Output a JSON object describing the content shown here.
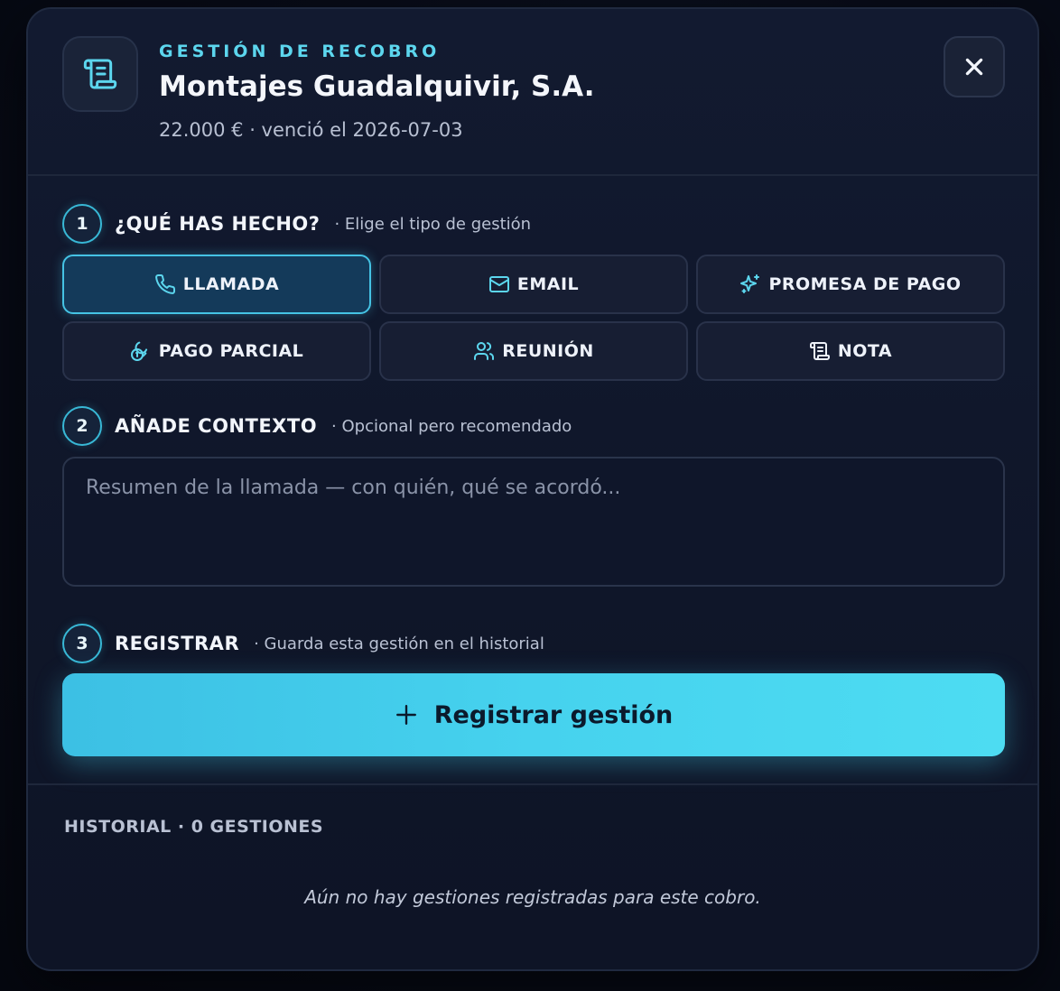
{
  "header": {
    "eyebrow": "GESTIÓN DE RECOBRO",
    "title": "Montajes Guadalquivir, S.A.",
    "subtitle": "22.000 € · venció el 2026-07-03",
    "icon": "scroll-icon",
    "close_icon": "close-icon"
  },
  "steps": [
    {
      "number": "1",
      "title": "¿QUÉ HAS HECHO?",
      "hint": "· Elige el tipo de gestión"
    },
    {
      "number": "2",
      "title": "AÑADE CONTEXTO",
      "hint": "· Opcional pero recomendado"
    },
    {
      "number": "3",
      "title": "REGISTRAR",
      "hint": "· Guarda esta gestión en el historial"
    }
  ],
  "actions": [
    {
      "label": "LLAMADA",
      "icon": "phone-icon",
      "selected": true
    },
    {
      "label": "EMAIL",
      "icon": "mail-icon",
      "selected": false
    },
    {
      "label": "PROMESA DE PAGO",
      "icon": "sparkles-icon",
      "selected": false
    },
    {
      "label": "PAGO PARCIAL",
      "icon": "coins-icon",
      "selected": false
    },
    {
      "label": "REUNIÓN",
      "icon": "users-icon",
      "selected": false
    },
    {
      "label": "NOTA",
      "icon": "scroll-icon",
      "selected": false
    }
  ],
  "context": {
    "placeholder": "Resumen de la llamada — con quién, qué se acordó...",
    "value": ""
  },
  "register": {
    "label": "Registrar gestión",
    "icon": "plus-icon"
  },
  "history": {
    "title": "HISTORIAL · 0 GESTIONES",
    "empty": "Aún no hay gestiones registradas para este cobro."
  },
  "colors": {
    "accent": "#46d2ee",
    "eyebrow": "#5cd6ee",
    "selected_bg": "#143a5a",
    "panel_bg": "#121a30"
  }
}
